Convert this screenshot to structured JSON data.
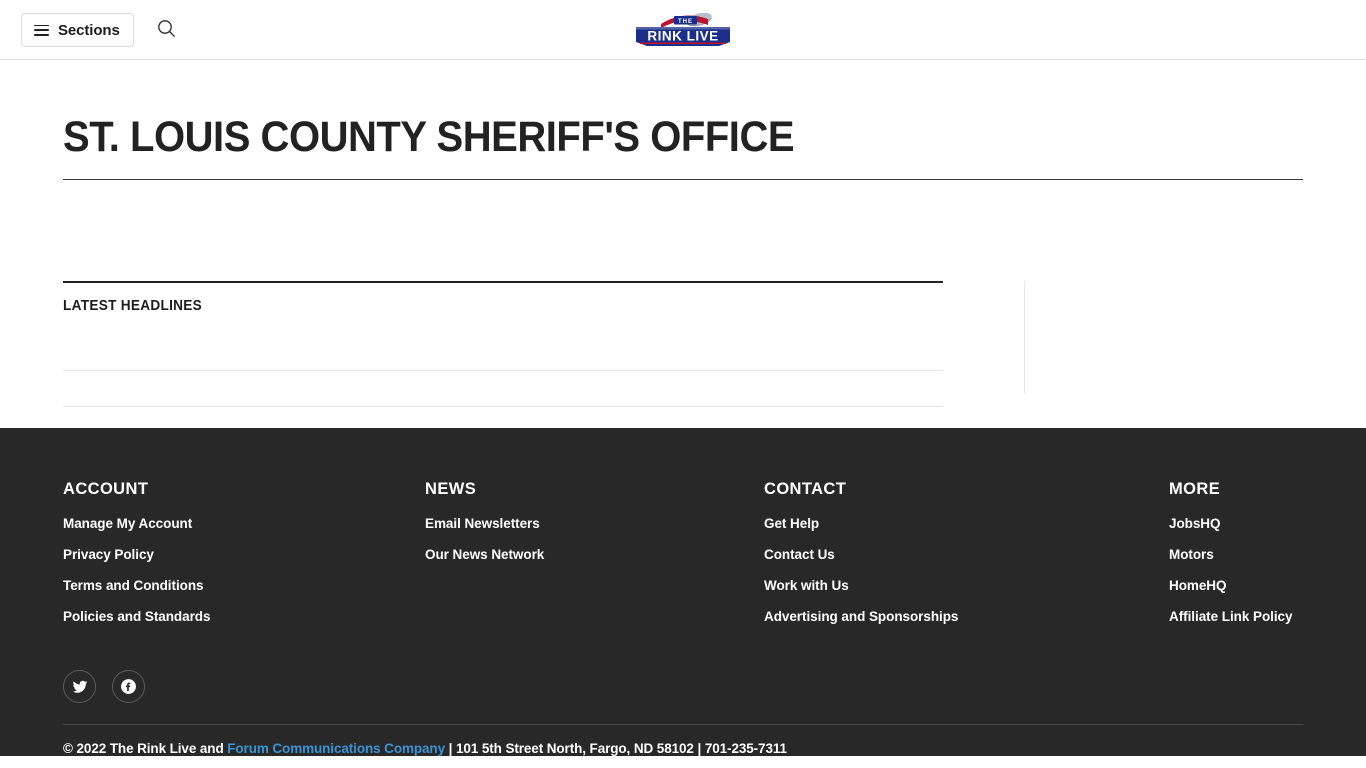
{
  "header": {
    "sections_label": "Sections",
    "menu_icon": "hamburger-icon",
    "search_icon": "search-icon",
    "logo": {
      "line1": "THE",
      "line2a": "RINK",
      "line2b": "LIVE",
      "alt": "The Rink Live",
      "colors": {
        "blue": "#1b2f8a",
        "red": "#c0122a",
        "white": "#ffffff"
      }
    }
  },
  "main": {
    "page_title": "ST. LOUIS COUNTY SHERIFF'S OFFICE",
    "headlines_heading": "LATEST HEADLINES",
    "headlines": []
  },
  "footer": {
    "columns": [
      {
        "title": "ACCOUNT",
        "links": [
          "Manage My Account",
          "Privacy Policy",
          "Terms and Conditions",
          "Policies and Standards"
        ]
      },
      {
        "title": "NEWS",
        "links": [
          "Email Newsletters",
          "Our News Network"
        ]
      },
      {
        "title": "CONTACT",
        "links": [
          "Get Help",
          "Contact Us",
          "Work with Us",
          "Advertising and Sponsorships"
        ]
      },
      {
        "title": "MORE",
        "links": [
          "JobsHQ",
          "Motors",
          "HomeHQ",
          "Affiliate Link Policy"
        ]
      }
    ],
    "social": [
      {
        "name": "twitter-icon",
        "label": "Twitter"
      },
      {
        "name": "facebook-icon",
        "label": "Facebook"
      }
    ],
    "copyright": {
      "before_link": "© 2022 The Rink Live and ",
      "link_text": "Forum Communications Company",
      "after_link": " | 101 5th Street North, Fargo, ND 58102 | 701-235-7311",
      "link_color": "#3b93d4"
    }
  },
  "theme": {
    "page_background": "#ffffff",
    "footer_background": "#282828",
    "text_color": "#222222",
    "rule_color": "#3a3a3a",
    "light_rule_color": "#e6e6e6"
  }
}
